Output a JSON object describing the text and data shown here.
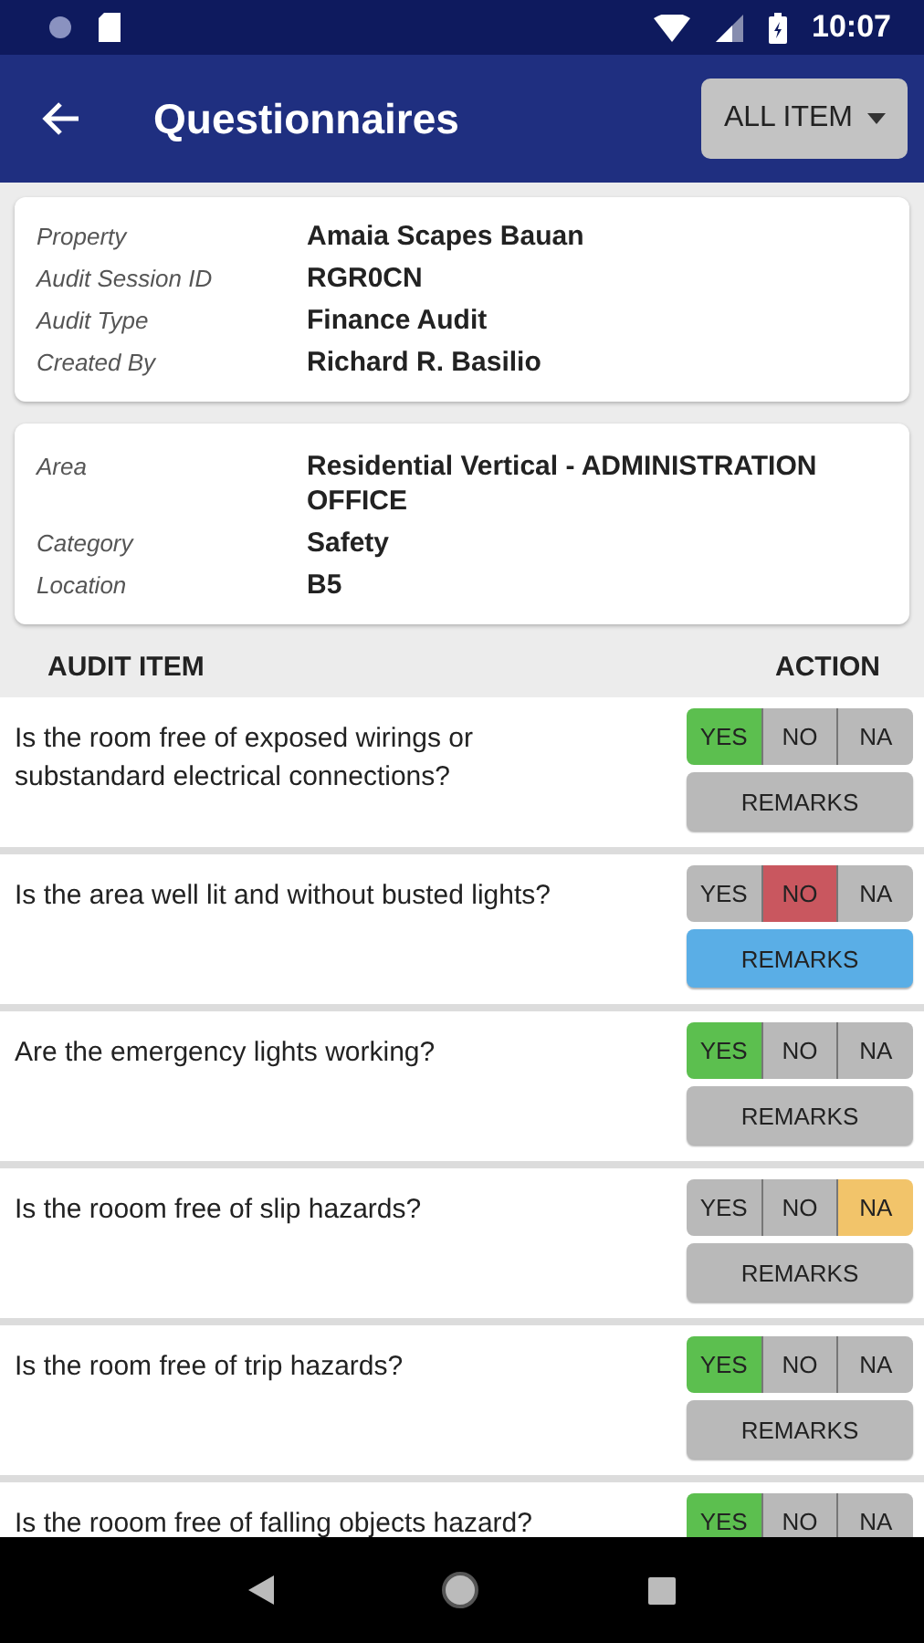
{
  "status_bar": {
    "time": "10:07"
  },
  "app_bar": {
    "title": "Questionnaires",
    "filter": "ALL ITEM"
  },
  "session_card": [
    {
      "label": "Property",
      "value": "Amaia Scapes Bauan"
    },
    {
      "label": "Audit Session ID",
      "value": "RGR0CN"
    },
    {
      "label": "Audit Type",
      "value": "Finance Audit"
    },
    {
      "label": "Created By",
      "value": "Richard R. Basilio"
    }
  ],
  "area_card": [
    {
      "label": "Area",
      "value": "Residential Vertical - ADMINISTRATION OFFICE"
    },
    {
      "label": "Category",
      "value": "Safety"
    },
    {
      "label": "Location",
      "value": "B5"
    }
  ],
  "table": {
    "columns": [
      "AUDIT ITEM",
      "ACTION"
    ],
    "rows": [
      {
        "question": "Is the room free of exposed wirings or substandard electrical connections?",
        "options": [
          {
            "label": "YES",
            "kind": "yes",
            "selected": true
          },
          {
            "label": "NO",
            "kind": "no",
            "selected": false
          },
          {
            "label": "NA",
            "kind": "na",
            "selected": false
          }
        ],
        "remarks": {
          "label": "REMARKS",
          "active": false
        }
      },
      {
        "question": "Is the area well lit and without busted lights?",
        "options": [
          {
            "label": "YES",
            "kind": "yes",
            "selected": false
          },
          {
            "label": "NO",
            "kind": "no",
            "selected": true
          },
          {
            "label": "NA",
            "kind": "na",
            "selected": false
          }
        ],
        "remarks": {
          "label": "REMARKS",
          "active": true
        }
      },
      {
        "question": "Are the emergency lights working?",
        "options": [
          {
            "label": "YES",
            "kind": "yes",
            "selected": true
          },
          {
            "label": "NO",
            "kind": "no",
            "selected": false
          },
          {
            "label": "NA",
            "kind": "na",
            "selected": false
          }
        ],
        "remarks": {
          "label": "REMARKS",
          "active": false
        }
      },
      {
        "question": "Is the rooom free of slip hazards?",
        "options": [
          {
            "label": "YES",
            "kind": "yes",
            "selected": false
          },
          {
            "label": "NO",
            "kind": "no",
            "selected": false
          },
          {
            "label": "NA",
            "kind": "na",
            "selected": true
          }
        ],
        "remarks": {
          "label": "REMARKS",
          "active": false
        }
      },
      {
        "question": "Is the room free of trip hazards?",
        "options": [
          {
            "label": "YES",
            "kind": "yes",
            "selected": true
          },
          {
            "label": "NO",
            "kind": "no",
            "selected": false
          },
          {
            "label": "NA",
            "kind": "na",
            "selected": false
          }
        ],
        "remarks": {
          "label": "REMARKS",
          "active": false
        }
      },
      {
        "question": "Is the rooom free of falling objects hazard?",
        "options": [
          {
            "label": "YES",
            "kind": "yes",
            "selected": true
          },
          {
            "label": "NO",
            "kind": "no",
            "selected": false
          },
          {
            "label": "NA",
            "kind": "na",
            "selected": false
          }
        ]
      }
    ]
  }
}
